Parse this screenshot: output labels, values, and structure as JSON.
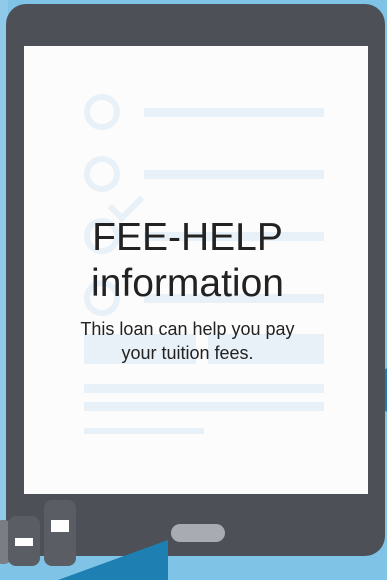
{
  "card": {
    "title_line1": "FEE-HELP",
    "title_line2": "information",
    "subtitle_line1": "This loan can help you pay",
    "subtitle_line2": "your tuition fees."
  },
  "colors": {
    "background": "#7fc3e6",
    "accent": "#1e7fb2",
    "device_frame": "#4d5157",
    "screen": "#fcfcfd",
    "text": "#222222"
  },
  "icons": [
    "tablet-icon",
    "phone-icon",
    "checkmark-icon"
  ]
}
